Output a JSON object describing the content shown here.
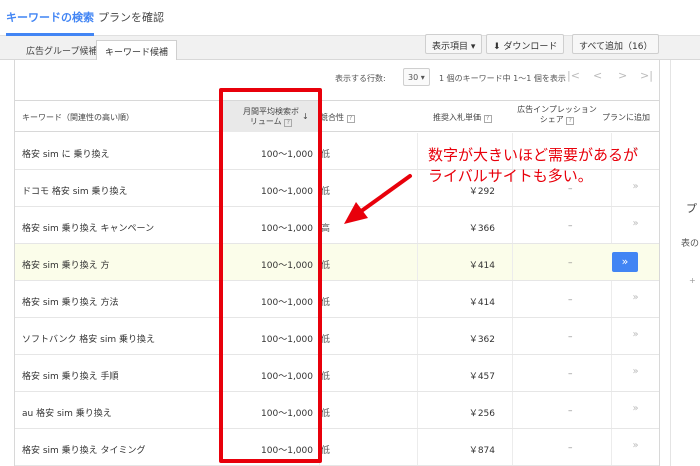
{
  "top_tabs": {
    "search": "キーワードの検索",
    "plan": "プランを確認"
  },
  "subtabs": {
    "ad_group": "広告グループ候補",
    "keyword": "キーワード候補"
  },
  "toolbar": {
    "columns": "表示項目",
    "download": "ダウンロード",
    "add_all": "すべて追加（16）"
  },
  "pager": {
    "rows_label": "表示する行数:",
    "rows_value": "30",
    "range": "1 個のキーワード中 1〜1 個を表示"
  },
  "table": {
    "headers": {
      "keyword": "キーワード（関連性の高い順）",
      "volume_line1": "月間平均検索ボ",
      "volume_line2": "リューム",
      "competition": "競合性",
      "bid": "推奨入札単価",
      "share_line1": "広告インプレッション",
      "share_line2": "シェア",
      "add": "プランに追加"
    },
    "rows": [
      {
        "keyword": "格安 sim に 乗り換え",
        "volume": "100〜1,000",
        "competition": "低",
        "bid": "",
        "share": ""
      },
      {
        "keyword": "ドコモ 格安 sim 乗り換え",
        "volume": "100〜1,000",
        "competition": "低",
        "bid": "￥292",
        "share": "–"
      },
      {
        "keyword": "格安 sim 乗り換え キャンペーン",
        "volume": "100〜1,000",
        "competition": "高",
        "bid": "￥366",
        "share": "–"
      },
      {
        "keyword": "格安 sim 乗り換え 方",
        "volume": "100〜1,000",
        "competition": "低",
        "bid": "￥414",
        "share": "–"
      },
      {
        "keyword": "格安 sim 乗り換え 方法",
        "volume": "100〜1,000",
        "competition": "低",
        "bid": "￥414",
        "share": "–"
      },
      {
        "keyword": "ソフトバンク 格安 sim 乗り換え",
        "volume": "100〜1,000",
        "competition": "低",
        "bid": "￥362",
        "share": "–"
      },
      {
        "keyword": "格安 sim 乗り換え 手順",
        "volume": "100〜1,000",
        "competition": "低",
        "bid": "￥457",
        "share": "–"
      },
      {
        "keyword": "au 格安 sim 乗り換え",
        "volume": "100〜1,000",
        "competition": "低",
        "bid": "￥256",
        "share": "–"
      },
      {
        "keyword": "格安 sim 乗り換え タイミング",
        "volume": "100〜1,000",
        "competition": "低",
        "bid": "￥874",
        "share": "–"
      }
    ],
    "add_glyph": "»",
    "highlighted_row": 3
  },
  "annotation": {
    "line1": "数字が大きいほど需要があるが",
    "line2": "ライバルサイトも多い。"
  },
  "side_panel": {
    "title_fragment": "プ",
    "text_fragment": "表の",
    "plus": "+"
  },
  "colors": {
    "accent": "#4285f4",
    "annotation_red": "#e8000b",
    "highlight_row": "#fbfdea"
  }
}
